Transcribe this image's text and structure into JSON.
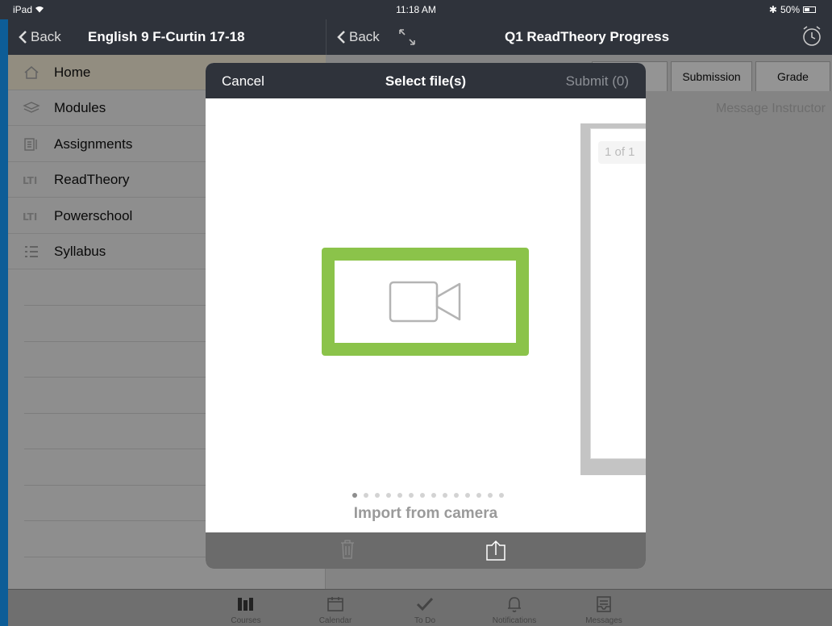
{
  "status_bar": {
    "device": "iPad",
    "time": "11:18 AM",
    "battery": "50%"
  },
  "left_nav": {
    "back_label": "Back",
    "title": "English 9 F-Curtin 17-18"
  },
  "right_nav": {
    "back_label": "Back",
    "title": "Q1 ReadTheory Progress"
  },
  "sidebar": {
    "items": [
      {
        "label": "Home",
        "icon": "home-icon"
      },
      {
        "label": "Modules",
        "icon": "layers-icon"
      },
      {
        "label": "Assignments",
        "icon": "assignments-icon"
      },
      {
        "label": "ReadTheory",
        "icon": "lti-icon"
      },
      {
        "label": "Powerschool",
        "icon": "lti-icon"
      },
      {
        "label": "Syllabus",
        "icon": "list-icon"
      }
    ]
  },
  "content": {
    "tabs": [
      "Submission",
      "Grade"
    ],
    "message_instructor": "Message Instructor"
  },
  "modal": {
    "cancel_label": "Cancel",
    "title": "Select file(s)",
    "submit_label": "Submit (0)",
    "preview_page": "1 of 1",
    "import_label": "Import from camera",
    "page_count": 14,
    "active_page": 1,
    "accent_color": "#8bc34a"
  },
  "tab_bar": {
    "items": [
      {
        "label": "Courses",
        "icon": "courses-icon"
      },
      {
        "label": "Calendar",
        "icon": "calendar-icon"
      },
      {
        "label": "To Do",
        "icon": "checkmark-icon"
      },
      {
        "label": "Notifications",
        "icon": "bell-icon"
      },
      {
        "label": "Messages",
        "icon": "inbox-icon"
      }
    ]
  }
}
